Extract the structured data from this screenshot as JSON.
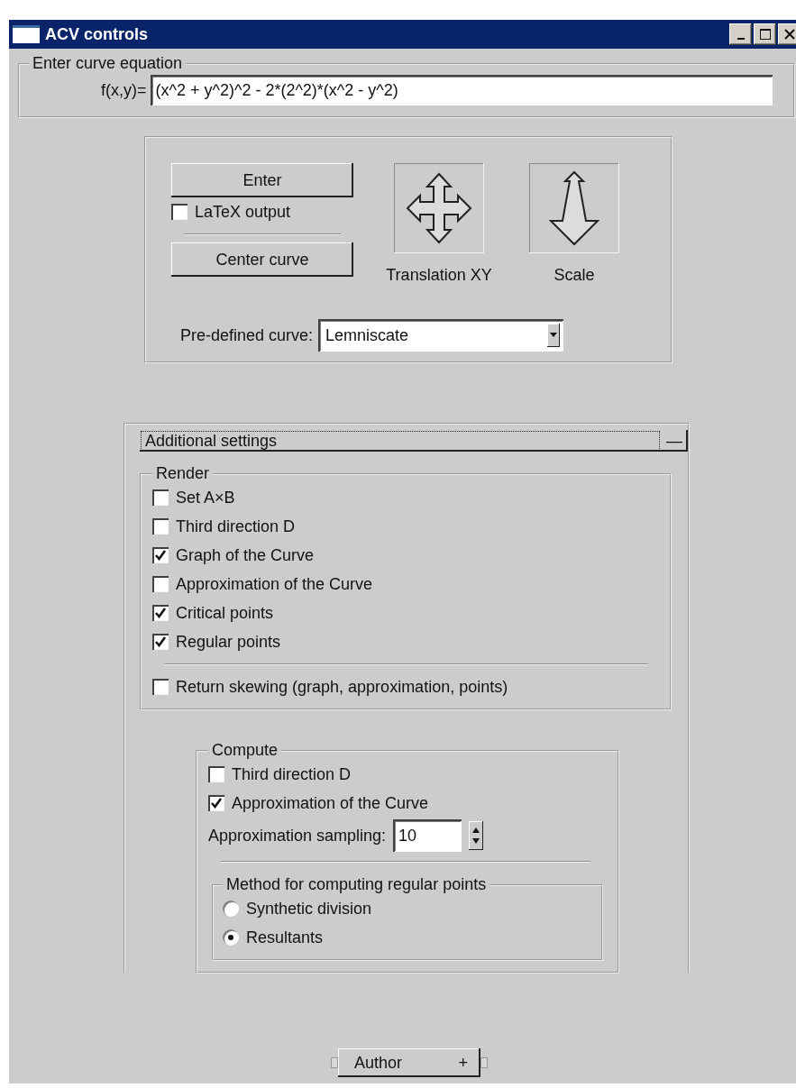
{
  "window": {
    "title": "ACV controls"
  },
  "equation": {
    "legend": "Enter curve equation",
    "label": "f(x,y)=",
    "value": "(x^2 + y^2)^2 - 2*(2^2)*(x^2 - y^2)"
  },
  "controls": {
    "enter_button": "Enter",
    "latex": {
      "label": "LaTeX output",
      "checked": false
    },
    "center_button": "Center curve",
    "tools": [
      {
        "kind": "translate",
        "label": "Translation XY"
      },
      {
        "kind": "scale",
        "label": "Scale"
      }
    ],
    "predefined": {
      "label": "Pre-defined curve:",
      "value": "Lemniscate"
    }
  },
  "additional": {
    "title": "Additional settings",
    "toggle": "—",
    "render": {
      "legend": "Render",
      "options": [
        {
          "label": "Set A×B",
          "checked": false
        },
        {
          "label": "Third direction D",
          "checked": false
        },
        {
          "label": "Graph of the Curve",
          "checked": true
        },
        {
          "label": "Approximation of the Curve",
          "checked": false
        },
        {
          "label": "Critical points",
          "checked": true
        },
        {
          "label": "Regular points",
          "checked": true
        }
      ],
      "extra": {
        "label": "Return skewing (graph, approximation, points)",
        "checked": false
      }
    },
    "compute": {
      "legend": "Compute",
      "options": [
        {
          "label": "Third direction D",
          "checked": false
        },
        {
          "label": "Approximation of the Curve",
          "checked": true
        }
      ],
      "sampling": {
        "label": "Approximation sampling:",
        "value": "10"
      },
      "method": {
        "legend": "Method for computing regular points",
        "options": [
          {
            "label": "Synthetic division",
            "selected": false
          },
          {
            "label": "Resultants",
            "selected": true
          }
        ]
      }
    }
  },
  "author": {
    "title": "Author",
    "toggle": "+"
  }
}
